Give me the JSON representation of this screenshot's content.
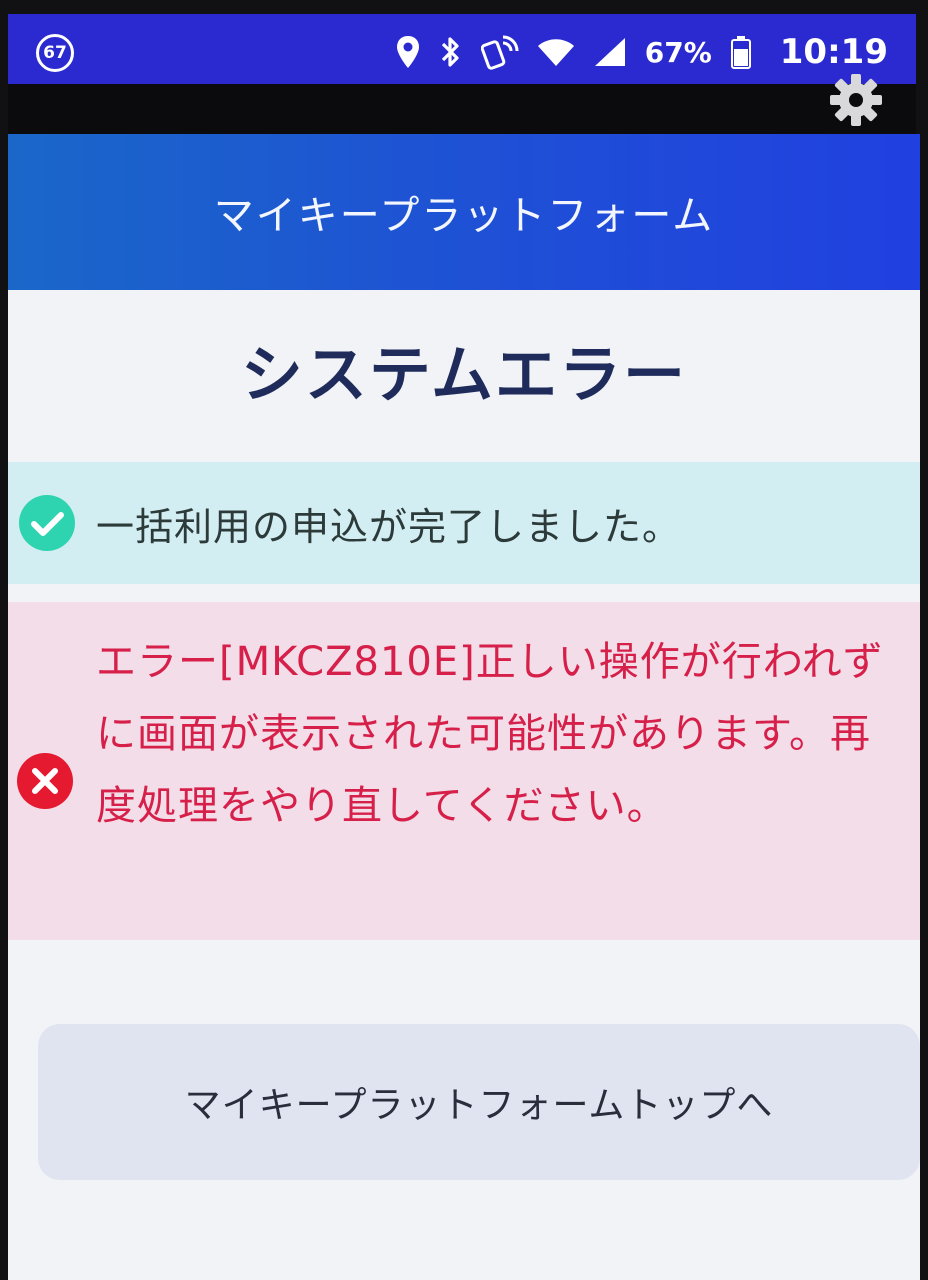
{
  "statusbar": {
    "notification_count": "67",
    "battery": "67%",
    "time": "10:19",
    "icons": [
      "location-icon",
      "bluetooth-icon",
      "nfc-icon",
      "wifi-icon",
      "cellular-icon",
      "battery-icon"
    ]
  },
  "app": {
    "header_title": "マイキープラットフォーム",
    "settings_icon": "gear-icon",
    "page_title": "システムエラー",
    "success_message": "一括利用の申込が完了しました。",
    "error_message": "エラー[MKCZ810E]正しい操作が行われずに画面が表示された可能性があります。再度処理をやり直してください。",
    "top_button_label": "マイキープラットフォームトップへ"
  },
  "colors": {
    "status_bar": "#2b2ad1",
    "header_start": "#1a67c9",
    "header_end": "#2040e0",
    "success_bg": "#d3eef2",
    "success_icon": "#2ed3b0",
    "error_bg": "#f3dde9",
    "error_text": "#d6204a",
    "title_text": "#1f2b5a",
    "button_bg": "#dfe4f0"
  }
}
